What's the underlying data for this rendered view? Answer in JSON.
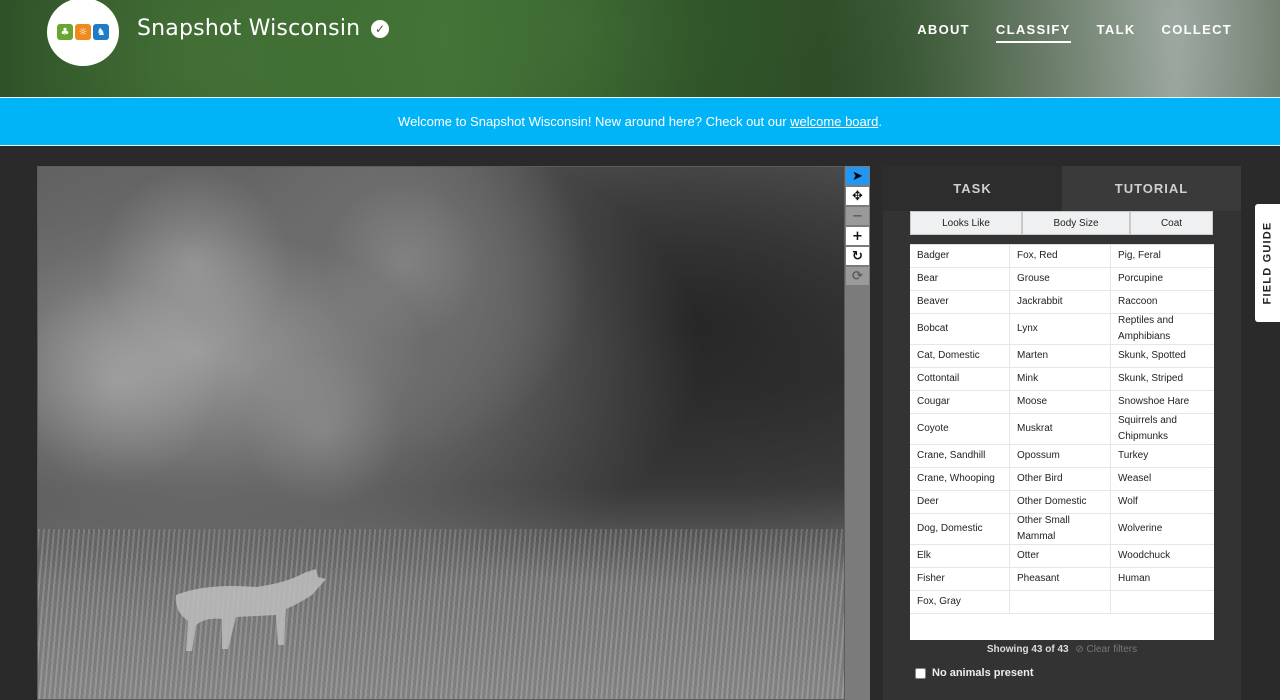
{
  "header": {
    "title": "Snapshot Wisconsin",
    "nav": [
      {
        "label": "ABOUT",
        "active": false
      },
      {
        "label": "CLASSIFY",
        "active": true
      },
      {
        "label": "TALK",
        "active": false
      },
      {
        "label": "COLLECT",
        "active": false
      }
    ]
  },
  "banner": {
    "text": "Welcome to Snapshot Wisconsin! New around here? Check out our ",
    "link": "welcome board",
    "suffix": "."
  },
  "toolbar": {
    "icons": [
      "pointer-icon",
      "move-icon",
      "zoom-out-icon",
      "zoom-in-icon",
      "rotate-icon",
      "reset-icon"
    ]
  },
  "panel": {
    "tabs": [
      "TASK",
      "TUTORIAL"
    ],
    "filters": [
      "Looks Like",
      "Body Size",
      "Coat"
    ],
    "species": [
      "Badger",
      "Fox, Red",
      "Pig, Feral",
      "Bear",
      "Grouse",
      "Porcupine",
      "Beaver",
      "Jackrabbit",
      "Raccoon",
      "Bobcat",
      "Lynx",
      "Reptiles and Amphibians",
      "Cat, Domestic",
      "Marten",
      "Skunk, Spotted",
      "Cottontail",
      "Mink",
      "Skunk, Striped",
      "Cougar",
      "Moose",
      "Snowshoe Hare",
      "Coyote",
      "Muskrat",
      "Squirrels and Chipmunks",
      "Crane, Sandhill",
      "Opossum",
      "Turkey",
      "Crane, Whooping",
      "Other Bird",
      "Weasel",
      "Deer",
      "Other Domestic",
      "Wolf",
      "Dog, Domestic",
      "Other Small Mammal",
      "Wolverine",
      "Elk",
      "Otter",
      "Woodchuck",
      "Fisher",
      "Pheasant",
      "Human",
      "Fox, Gray",
      "",
      ""
    ],
    "count_text": "Showing 43 of 43",
    "clear_filters": "Clear filters",
    "no_animals": "No animals present"
  },
  "field_guide": "FIELD GUIDE",
  "colors": {
    "banner": "#00b4f7",
    "active_tool": "#2196f3"
  }
}
